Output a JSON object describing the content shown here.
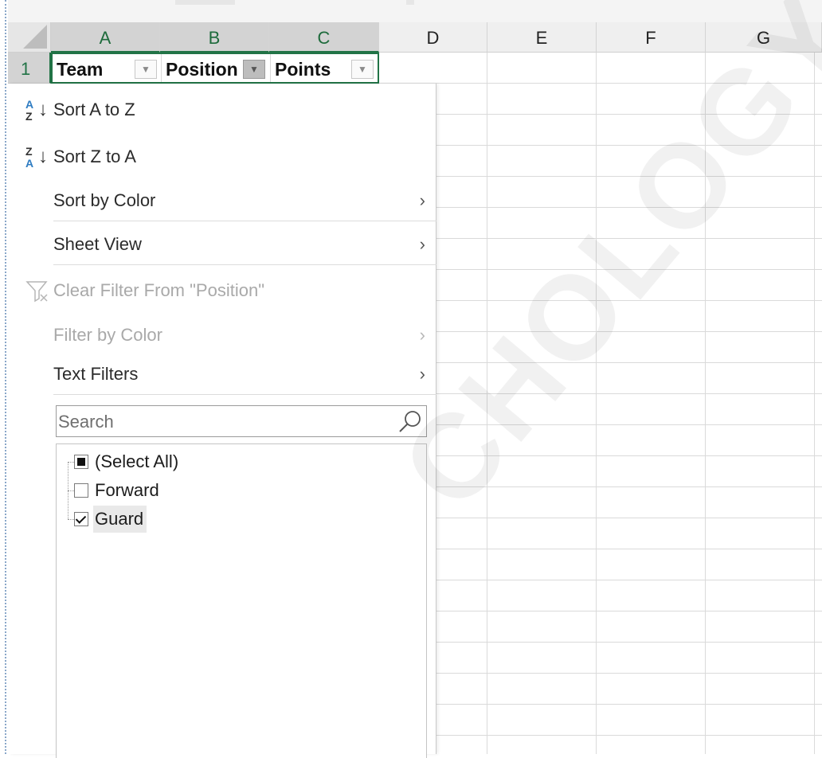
{
  "columns": [
    "A",
    "B",
    "C",
    "D",
    "E",
    "F",
    "G"
  ],
  "row_number": "1",
  "header_cells": [
    {
      "text": "Team",
      "filter_state": "inactive"
    },
    {
      "text": "Position",
      "filter_state": "active"
    },
    {
      "text": "Points",
      "filter_state": "inactive"
    }
  ],
  "menu": {
    "sort_az": "Sort A to Z",
    "sort_za": "Sort Z to A",
    "sort_by_color": "Sort by Color",
    "sheet_view": "Sheet View",
    "clear_filter": "Clear Filter From \"Position\"",
    "filter_by_color": "Filter by Color",
    "text_filters": "Text Filters"
  },
  "search": {
    "placeholder": "Search",
    "value": ""
  },
  "filter_values": [
    {
      "label": "(Select All)",
      "state": "partial"
    },
    {
      "label": "Forward",
      "state": "unchecked"
    },
    {
      "label": "Guard",
      "state": "checked"
    }
  ],
  "watermark": "CHOLOGY.CO",
  "colors": {
    "accent_green": "#217346",
    "disabled_text": "#a9a9a9",
    "sort_icon_blue": "#2e7cc2"
  },
  "icons": {
    "sort_az": "sort-ascending-icon",
    "sort_za": "sort-descending-icon",
    "submenu": "chevron-right-icon",
    "clear_filter": "clear-filter-icon",
    "search": "magnifier-icon",
    "filter_dropdown": "dropdown-arrow-icon"
  }
}
